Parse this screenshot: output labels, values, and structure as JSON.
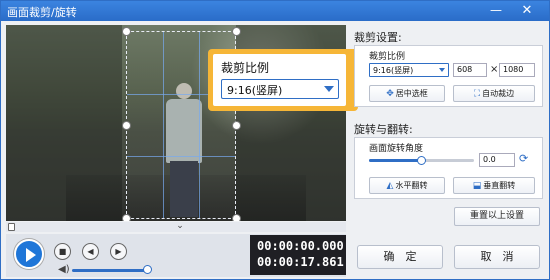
{
  "window": {
    "title": "画面裁剪/旋转",
    "minimize_glyph": "—",
    "close_glyph": "✕"
  },
  "preview": {
    "callout": {
      "title": "裁剪比例",
      "selected": "9:16(竖屏)"
    },
    "timeline_chevron": "⌄"
  },
  "player": {
    "current_time": "00:00:00.000",
    "total_time": "00:00:17.861",
    "volume_level_pct": 90,
    "icons": [
      "play-icon",
      "stop-icon",
      "prev-frame-icon",
      "next-frame-icon",
      "volume-icon"
    ]
  },
  "crop": {
    "section_title": "裁剪设置:",
    "ratio_label": "裁剪比例",
    "ratio_value": "9:16(竖屏)",
    "width": "608",
    "times": "×",
    "height": "1080",
    "center_button": "居中选框",
    "auto_crop_button": "自动裁边"
  },
  "rotate": {
    "section_title": "旋转与翻转:",
    "angle_label": "画面旋转角度",
    "angle_value": "0.0",
    "angle_slider_pct": 50,
    "hflip_button": "水平翻转",
    "vflip_button": "垂直翻转",
    "reset_button": "重置以上设置"
  },
  "footer": {
    "ok": "确　定",
    "cancel": "取　消"
  },
  "colors": {
    "accent": "#2f6ec5",
    "callout": "#f6b637",
    "titlebar": "#2a6cc8"
  }
}
